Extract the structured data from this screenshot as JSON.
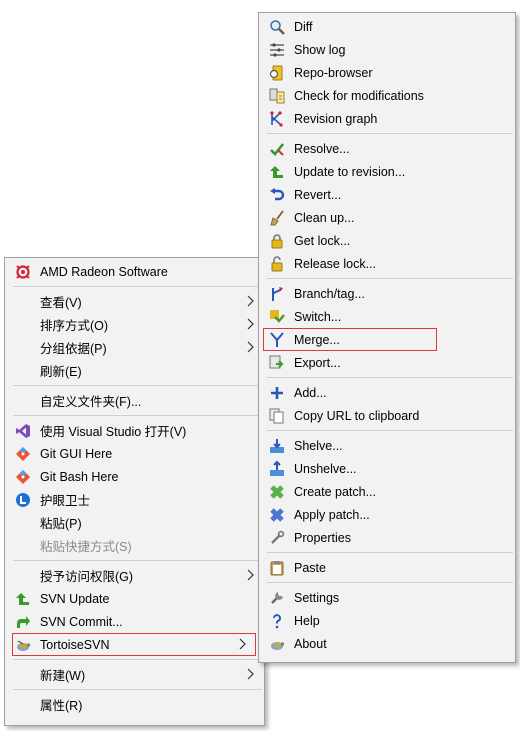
{
  "left_menu": {
    "items": [
      {
        "label": "AMD Radeon Software",
        "icon": "amd-radeon-icon"
      },
      {
        "label": "查看(V)",
        "submenu": true
      },
      {
        "label": "排序方式(O)",
        "submenu": true
      },
      {
        "label": "分组依据(P)",
        "submenu": true
      },
      {
        "label": "刷新(E)"
      },
      {
        "label": "自定义文件夹(F)..."
      },
      {
        "label": "使用 Visual Studio 打开(V)",
        "icon": "visual-studio-icon"
      },
      {
        "label": "Git GUI Here",
        "icon": "git-icon"
      },
      {
        "label": "Git Bash Here",
        "icon": "git-icon"
      },
      {
        "label": "护眼卫士",
        "icon": "eye-guard-icon"
      },
      {
        "label": "粘贴(P)"
      },
      {
        "label": "粘贴快捷方式(S)",
        "disabled": true
      },
      {
        "label": "授予访问权限(G)",
        "submenu": true
      },
      {
        "label": "SVN Update",
        "icon": "svn-update-icon"
      },
      {
        "label": "SVN Commit...",
        "icon": "svn-commit-icon"
      },
      {
        "label": "TortoiseSVN",
        "icon": "tortoisesvn-icon",
        "submenu": true,
        "highlighted": true
      },
      {
        "label": "新建(W)",
        "submenu": true
      },
      {
        "label": "属性(R)"
      }
    ]
  },
  "right_menu": {
    "items": [
      {
        "label": "Diff",
        "icon": "diff-icon"
      },
      {
        "label": "Show log",
        "icon": "show-log-icon"
      },
      {
        "label": "Repo-browser",
        "icon": "repo-browser-icon"
      },
      {
        "label": "Check for modifications",
        "icon": "check-modifications-icon"
      },
      {
        "label": "Revision graph",
        "icon": "revision-graph-icon"
      },
      {
        "label": "Resolve...",
        "icon": "resolve-icon"
      },
      {
        "label": "Update to revision...",
        "icon": "update-revision-icon"
      },
      {
        "label": "Revert...",
        "icon": "revert-icon"
      },
      {
        "label": "Clean up...",
        "icon": "cleanup-icon"
      },
      {
        "label": "Get lock...",
        "icon": "lock-icon"
      },
      {
        "label": "Release lock...",
        "icon": "unlock-icon"
      },
      {
        "label": "Branch/tag...",
        "icon": "branch-icon"
      },
      {
        "label": "Switch...",
        "icon": "switch-icon"
      },
      {
        "label": "Merge...",
        "icon": "merge-icon",
        "highlighted": true
      },
      {
        "label": "Export...",
        "icon": "export-icon"
      },
      {
        "label": "Add...",
        "icon": "add-icon"
      },
      {
        "label": "Copy URL to clipboard",
        "icon": "copy-url-icon"
      },
      {
        "label": "Shelve...",
        "icon": "shelve-icon"
      },
      {
        "label": "Unshelve...",
        "icon": "unshelve-icon"
      },
      {
        "label": "Create patch...",
        "icon": "create-patch-icon"
      },
      {
        "label": "Apply patch...",
        "icon": "apply-patch-icon"
      },
      {
        "label": "Properties",
        "icon": "properties-icon"
      },
      {
        "label": "Paste",
        "icon": "paste-icon"
      },
      {
        "label": "Settings",
        "icon": "settings-icon"
      },
      {
        "label": "Help",
        "icon": "help-icon"
      },
      {
        "label": "About",
        "icon": "about-icon"
      }
    ]
  },
  "colors": {
    "menu_background": "#f2f2f2",
    "menu_border": "#a0a0a0",
    "separator": "#cfcfcf",
    "highlight_outline": "#d9383c",
    "disabled_text": "#8a8a8a"
  }
}
